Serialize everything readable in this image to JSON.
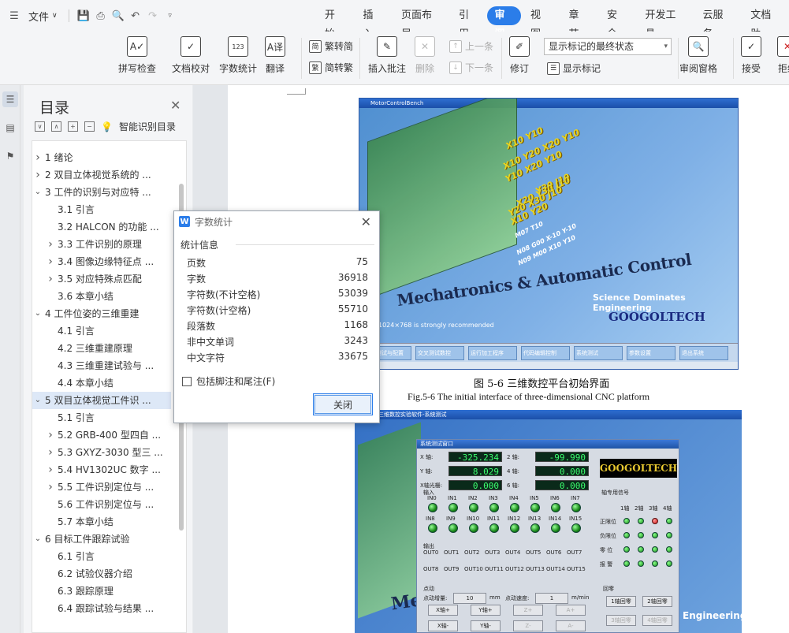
{
  "menubar": {
    "file_label": "文件",
    "tabs": [
      "开始",
      "插入",
      "页面布局",
      "引用",
      "审阅",
      "视图",
      "章节",
      "安全",
      "开发工具",
      "云服务",
      "文档助"
    ],
    "active_tab": "审阅"
  },
  "ribbon": {
    "spellcheck": "拼写检查",
    "doc_proof": "文档校对",
    "word_count": "字数统计",
    "translate": "翻译",
    "trad_to_simp": "繁转简",
    "simp_to_trad": "简转繁",
    "insert_comment": "插入批注",
    "delete": "删除",
    "prev": "上一条",
    "next": "下一条",
    "revise": "修订",
    "display_mode": "显示标记的最终状态",
    "show_markup": "显示标记",
    "review_pane": "审阅窗格",
    "accept": "接受",
    "reject": "拒绝"
  },
  "toc": {
    "title": "目录",
    "smart_toc": "智能识别目录",
    "items": [
      {
        "level": 1,
        "chev": ">",
        "text": "1  绪论"
      },
      {
        "level": 1,
        "chev": ">",
        "text": "2  双目立体视觉系统的 ..."
      },
      {
        "level": 1,
        "chev": "v",
        "text": "3  工件的识别与对应特 ..."
      },
      {
        "level": 2,
        "chev": "",
        "text": "3.1  引言"
      },
      {
        "level": 2,
        "chev": "",
        "text": "3.2 HALCON 的功能 ..."
      },
      {
        "level": 2,
        "chev": ">",
        "text": "3.3 工件识别的原理"
      },
      {
        "level": 2,
        "chev": ">",
        "text": "3.4 图像边缘特征点 ..."
      },
      {
        "level": 2,
        "chev": ">",
        "text": "3.5  对应特殊点匹配"
      },
      {
        "level": 2,
        "chev": "",
        "text": "3.6  本章小结"
      },
      {
        "level": 1,
        "chev": "v",
        "text": "4  工件位姿的三维重建"
      },
      {
        "level": 2,
        "chev": "",
        "text": "4.1  引言"
      },
      {
        "level": 2,
        "chev": "",
        "text": "4.2  三维重建原理"
      },
      {
        "level": 2,
        "chev": "",
        "text": "4.3  三维重建试验与 ..."
      },
      {
        "level": 2,
        "chev": "",
        "text": "4.4  本章小结"
      },
      {
        "level": 1,
        "chev": "v",
        "text": "5  双目立体视觉工件识 ..."
      },
      {
        "level": 2,
        "chev": "",
        "text": "5.1  引言"
      },
      {
        "level": 2,
        "chev": ">",
        "text": "5.2 GRB-400 型四自 ..."
      },
      {
        "level": 2,
        "chev": ">",
        "text": "5.3 GXYZ-3030 型三 ..."
      },
      {
        "level": 2,
        "chev": ">",
        "text": "5.4 HV1302UC 数字 ..."
      },
      {
        "level": 2,
        "chev": ">",
        "text": "5.5 工件识别定位与 ..."
      },
      {
        "level": 2,
        "chev": "",
        "text": "5.6  工件识别定位与 ..."
      },
      {
        "level": 2,
        "chev": "",
        "text": "5.7  本章小结"
      },
      {
        "level": 1,
        "chev": "v",
        "text": "6  目标工件跟踪试验"
      },
      {
        "level": 2,
        "chev": "",
        "text": "6.1 引言"
      },
      {
        "level": 2,
        "chev": "",
        "text": "6.2  试验仪器介绍"
      },
      {
        "level": 2,
        "chev": "",
        "text": "6.3  跟踪原理"
      },
      {
        "level": 2,
        "chev": "",
        "text": "6.4  跟踪试验与结果 ..."
      }
    ],
    "selected_index": 14
  },
  "dialog": {
    "title": "字数统计",
    "section": "统计信息",
    "stats": [
      {
        "label": "页数",
        "value": "75"
      },
      {
        "label": "字数",
        "value": "36918"
      },
      {
        "label": "字符数(不计空格)",
        "value": "53039"
      },
      {
        "label": "字符数(计空格)",
        "value": "55710"
      },
      {
        "label": "段落数",
        "value": "1168"
      },
      {
        "label": "非中文单词",
        "value": "3243"
      },
      {
        "label": "中文字符",
        "value": "33675"
      }
    ],
    "checkbox_label": "包括脚注和尾注(F)",
    "close_label": "关闭"
  },
  "figure1": {
    "window_title": "MotorControlBench",
    "axes_labels": [
      "X10 Y10",
      "X10 Y20 X20 Y10",
      "Y10 X20 Y10",
      "Y30 J10",
      "X20 Y30 J10",
      "Y20 X30 J10",
      "X10 Y20",
      "M07 T10",
      "N08 G00 X-10 Y-10",
      "N09 M00 X10 Y10"
    ],
    "brand_text": "Mechatronics & Automatic Control",
    "slogan": "Science Dominates Engineering",
    "logo": "GOOGOLTECH",
    "resolution_note": "1024×768 is strongly recommended",
    "buttons": [
      "系统测试与配置",
      "交叉测试数控",
      "运行加工程序",
      "代码编辑控制",
      "系统测试",
      "参数设置",
      "退出系统"
    ],
    "caption_cn": "图 5-6    三维数控平台初始界面",
    "caption_en": "Fig.5-6 The initial interface of three-dimensional CNC platform"
  },
  "figure2": {
    "window_title": "三维数控实验软件-系统测试",
    "panel_title": "系统测试窗口",
    "logo": "GOOGOLTECH",
    "engineering": "Engineering",
    "mech": "Mec",
    "axis_labels": [
      "X 轴:",
      "Y 轴:",
      "X轴光栅:"
    ],
    "axis_labels_right": [
      "2 轴:",
      "4 轴:",
      "6 轴:"
    ],
    "lcd_left": [
      "-325.234",
      "8.029",
      "0.000"
    ],
    "lcd_right": [
      "-99.990",
      "0.000",
      "0.000"
    ],
    "input_label": "输入",
    "inputs_row1": [
      "IN0",
      "IN1",
      "IN2",
      "IN3",
      "IN4",
      "IN5",
      "IN6",
      "IN7"
    ],
    "inputs_row2": [
      "IN8",
      "IN9",
      "IN10",
      "IN11",
      "IN12",
      "IN13",
      "IN14",
      "IN15"
    ],
    "output_label": "输出",
    "outputs_row1": [
      "OUT0",
      "OUT1",
      "OUT2",
      "OUT3",
      "OUT4",
      "OUT5",
      "OUT6",
      "OUT7"
    ],
    "outputs_row2": [
      "OUT8",
      "OUT9",
      "OUT10",
      "OUT11",
      "OUT12",
      "OUT13",
      "OUT14",
      "OUT15"
    ],
    "axis_signal_label": "轴专用信号",
    "axis_cols": [
      "1轴",
      "2轴",
      "3轴",
      "4轴"
    ],
    "signal_rows": [
      "正限位",
      "负限位",
      "零 位",
      "报 警"
    ],
    "jog_label": "点动",
    "jog_step_label": "点动增量:",
    "jog_step_value": "10",
    "jog_step_unit": "mm",
    "jog_speed_label": "点动速度:",
    "jog_speed_value": "1",
    "jog_speed_unit": "m/min",
    "jog_buttons": [
      "X轴+",
      "Y轴+",
      "Z+",
      "A+",
      "X轴-",
      "Y轴-",
      "Z-",
      "A-"
    ],
    "home_label": "回零",
    "home_buttons": [
      "1轴回零",
      "2轴回零",
      "3轴回零",
      "4轴回零"
    ]
  }
}
